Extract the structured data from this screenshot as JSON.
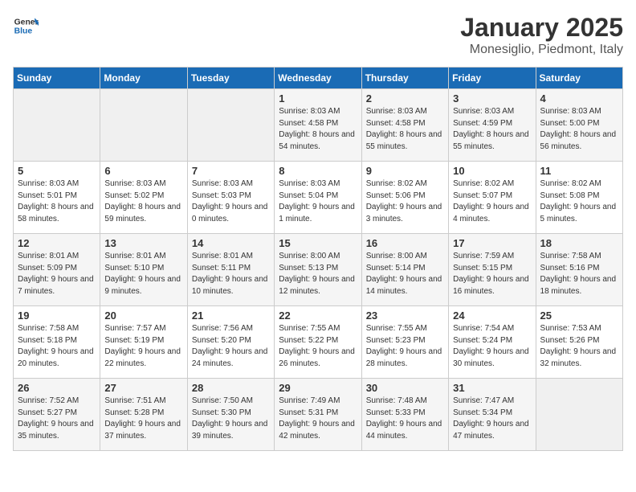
{
  "header": {
    "logo_line1": "General",
    "logo_line2": "Blue",
    "title": "January 2025",
    "subtitle": "Monesiglio, Piedmont, Italy"
  },
  "weekdays": [
    "Sunday",
    "Monday",
    "Tuesday",
    "Wednesday",
    "Thursday",
    "Friday",
    "Saturday"
  ],
  "weeks": [
    [
      {
        "day": "",
        "empty": true
      },
      {
        "day": "",
        "empty": true
      },
      {
        "day": "",
        "empty": true
      },
      {
        "day": "1",
        "sunrise": "8:03 AM",
        "sunset": "4:58 PM",
        "daylight": "8 hours and 54 minutes."
      },
      {
        "day": "2",
        "sunrise": "8:03 AM",
        "sunset": "4:58 PM",
        "daylight": "8 hours and 55 minutes."
      },
      {
        "day": "3",
        "sunrise": "8:03 AM",
        "sunset": "4:59 PM",
        "daylight": "8 hours and 55 minutes."
      },
      {
        "day": "4",
        "sunrise": "8:03 AM",
        "sunset": "5:00 PM",
        "daylight": "8 hours and 56 minutes."
      }
    ],
    [
      {
        "day": "5",
        "sunrise": "8:03 AM",
        "sunset": "5:01 PM",
        "daylight": "8 hours and 58 minutes."
      },
      {
        "day": "6",
        "sunrise": "8:03 AM",
        "sunset": "5:02 PM",
        "daylight": "8 hours and 59 minutes."
      },
      {
        "day": "7",
        "sunrise": "8:03 AM",
        "sunset": "5:03 PM",
        "daylight": "9 hours and 0 minutes."
      },
      {
        "day": "8",
        "sunrise": "8:03 AM",
        "sunset": "5:04 PM",
        "daylight": "9 hours and 1 minute."
      },
      {
        "day": "9",
        "sunrise": "8:02 AM",
        "sunset": "5:06 PM",
        "daylight": "9 hours and 3 minutes."
      },
      {
        "day": "10",
        "sunrise": "8:02 AM",
        "sunset": "5:07 PM",
        "daylight": "9 hours and 4 minutes."
      },
      {
        "day": "11",
        "sunrise": "8:02 AM",
        "sunset": "5:08 PM",
        "daylight": "9 hours and 5 minutes."
      }
    ],
    [
      {
        "day": "12",
        "sunrise": "8:01 AM",
        "sunset": "5:09 PM",
        "daylight": "9 hours and 7 minutes."
      },
      {
        "day": "13",
        "sunrise": "8:01 AM",
        "sunset": "5:10 PM",
        "daylight": "9 hours and 9 minutes."
      },
      {
        "day": "14",
        "sunrise": "8:01 AM",
        "sunset": "5:11 PM",
        "daylight": "9 hours and 10 minutes."
      },
      {
        "day": "15",
        "sunrise": "8:00 AM",
        "sunset": "5:13 PM",
        "daylight": "9 hours and 12 minutes."
      },
      {
        "day": "16",
        "sunrise": "8:00 AM",
        "sunset": "5:14 PM",
        "daylight": "9 hours and 14 minutes."
      },
      {
        "day": "17",
        "sunrise": "7:59 AM",
        "sunset": "5:15 PM",
        "daylight": "9 hours and 16 minutes."
      },
      {
        "day": "18",
        "sunrise": "7:58 AM",
        "sunset": "5:16 PM",
        "daylight": "9 hours and 18 minutes."
      }
    ],
    [
      {
        "day": "19",
        "sunrise": "7:58 AM",
        "sunset": "5:18 PM",
        "daylight": "9 hours and 20 minutes."
      },
      {
        "day": "20",
        "sunrise": "7:57 AM",
        "sunset": "5:19 PM",
        "daylight": "9 hours and 22 minutes."
      },
      {
        "day": "21",
        "sunrise": "7:56 AM",
        "sunset": "5:20 PM",
        "daylight": "9 hours and 24 minutes."
      },
      {
        "day": "22",
        "sunrise": "7:55 AM",
        "sunset": "5:22 PM",
        "daylight": "9 hours and 26 minutes."
      },
      {
        "day": "23",
        "sunrise": "7:55 AM",
        "sunset": "5:23 PM",
        "daylight": "9 hours and 28 minutes."
      },
      {
        "day": "24",
        "sunrise": "7:54 AM",
        "sunset": "5:24 PM",
        "daylight": "9 hours and 30 minutes."
      },
      {
        "day": "25",
        "sunrise": "7:53 AM",
        "sunset": "5:26 PM",
        "daylight": "9 hours and 32 minutes."
      }
    ],
    [
      {
        "day": "26",
        "sunrise": "7:52 AM",
        "sunset": "5:27 PM",
        "daylight": "9 hours and 35 minutes."
      },
      {
        "day": "27",
        "sunrise": "7:51 AM",
        "sunset": "5:28 PM",
        "daylight": "9 hours and 37 minutes."
      },
      {
        "day": "28",
        "sunrise": "7:50 AM",
        "sunset": "5:30 PM",
        "daylight": "9 hours and 39 minutes."
      },
      {
        "day": "29",
        "sunrise": "7:49 AM",
        "sunset": "5:31 PM",
        "daylight": "9 hours and 42 minutes."
      },
      {
        "day": "30",
        "sunrise": "7:48 AM",
        "sunset": "5:33 PM",
        "daylight": "9 hours and 44 minutes."
      },
      {
        "day": "31",
        "sunrise": "7:47 AM",
        "sunset": "5:34 PM",
        "daylight": "9 hours and 47 minutes."
      },
      {
        "day": "",
        "empty": true
      }
    ]
  ]
}
